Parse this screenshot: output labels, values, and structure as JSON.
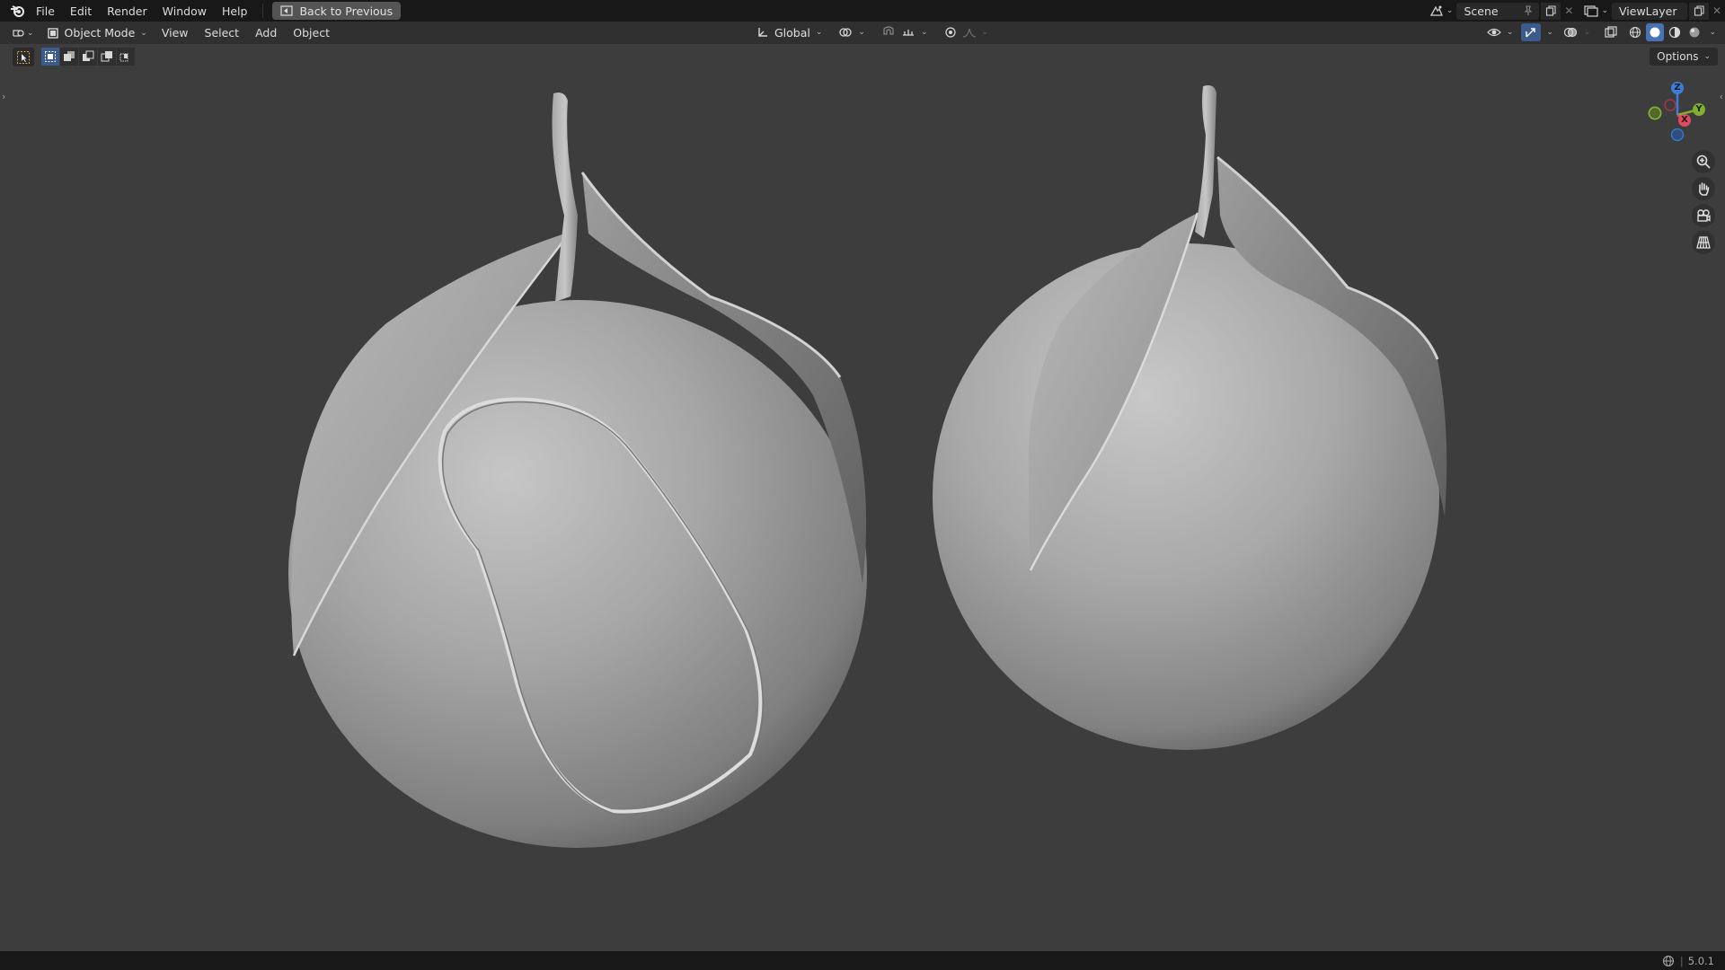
{
  "topbar": {
    "menus": [
      "File",
      "Edit",
      "Render",
      "Window",
      "Help"
    ],
    "back_button": "Back to Previous",
    "scene_name": "Scene",
    "view_layer": "ViewLayer"
  },
  "header": {
    "mode": "Object Mode",
    "menus": [
      "View",
      "Select",
      "Add",
      "Object"
    ],
    "transform_orientation": "Global"
  },
  "viewport": {
    "options_label": "Options",
    "gizmo_axes": [
      "X",
      "Y",
      "Z"
    ]
  },
  "status": {
    "version": "5.0.1"
  },
  "colors": {
    "viewport_bg": "#3d3d3d",
    "topbar_bg": "#181818",
    "header_bg": "#303030",
    "axis_x": "#e34a5f",
    "axis_y": "#7fb02e",
    "axis_z": "#3c7dd9",
    "selection_accent": "#4772b3"
  }
}
